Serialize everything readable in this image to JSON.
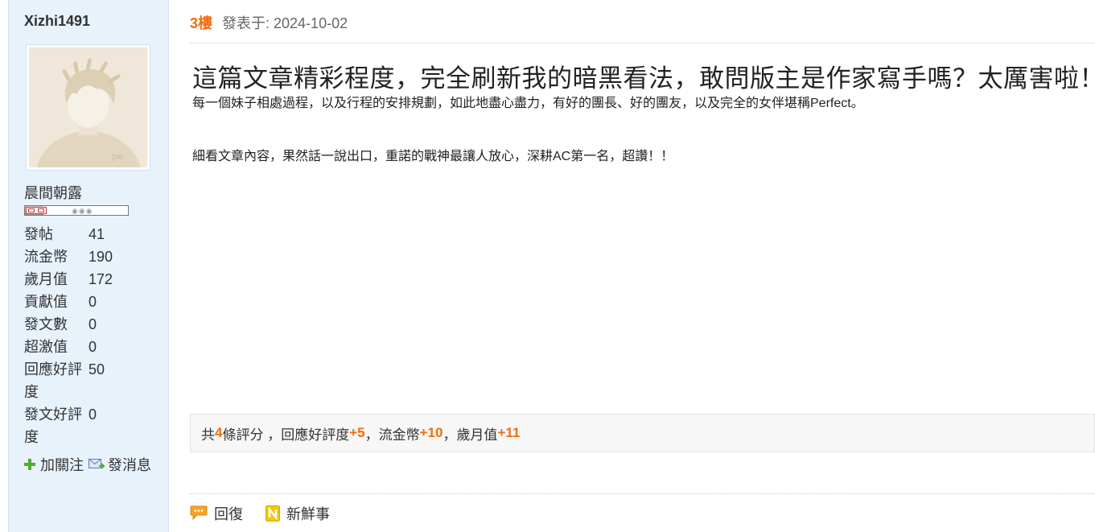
{
  "colors": {
    "accent": "#f26c0d",
    "sidebar_bg": "#e8f2fb"
  },
  "user": {
    "name": "Xizhi1491",
    "avatar_watermark": "pw",
    "rank_title": "晨間朝露",
    "rank_progress": 0.18,
    "stats": [
      {
        "label": "發帖",
        "value": "41"
      },
      {
        "label": "流金幣",
        "value": "190"
      },
      {
        "label": "歲月值",
        "value": "172"
      },
      {
        "label": "貢獻值",
        "value": "0"
      },
      {
        "label": "發文數",
        "value": "0"
      },
      {
        "label": "超激值",
        "value": "0"
      },
      {
        "label": "回應好評度",
        "value": "50"
      },
      {
        "label": "發文好評度",
        "value": "0"
      }
    ],
    "actions": {
      "follow": {
        "label": "加關注",
        "icon": "plus-icon"
      },
      "message": {
        "label": "發消息",
        "icon": "mail-icon"
      }
    }
  },
  "post": {
    "floor": "3樓",
    "posted_at": "發表于: 2024-10-02",
    "title": "這篇文章精彩程度，完全刷新我的暗黑看法，敢問版主是作家寫手嗎？太厲害啦！",
    "paragraphs": [
      "每一個妹子相處過程，以及行程的安排規劃，如此地盡心盡力，有好的團長、好的團友，以及完全的女伴堪稱Perfect。",
      "細看文章內容，果然話一說出口，重諾的戰神最讓人放心，深耕AC第一名，超讚！！"
    ]
  },
  "rating": {
    "prefix": "共",
    "count": "4",
    "suffix": "條評分 ，",
    "items": [
      {
        "label": "回應好評度",
        "value": "+5",
        "sep": " ，"
      },
      {
        "label": "流金幣",
        "value": "+10",
        "sep": " ，"
      },
      {
        "label": "歲月值",
        "value": "+11",
        "sep": ""
      }
    ]
  },
  "post_actions": {
    "reply": {
      "label": "回復",
      "icon": "reply-icon"
    },
    "fresh": {
      "label": "新鮮事",
      "icon": "fresh-icon"
    }
  }
}
